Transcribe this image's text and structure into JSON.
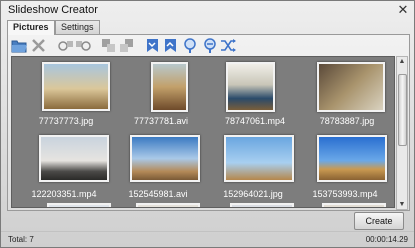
{
  "window": {
    "title": "Slideshow Creator"
  },
  "tabs": [
    {
      "label": "Pictures"
    },
    {
      "label": "Settings"
    }
  ],
  "toolbar": {
    "icons": [
      "open-folder-icon",
      "delete-icon",
      "move-left-icon",
      "move-right-icon",
      "move-up-icon",
      "move-down-icon",
      "sort-first-icon",
      "sort-last-icon",
      "zoom-in-icon",
      "zoom-out-icon",
      "shuffle-icon"
    ]
  },
  "items": [
    {
      "name": "77737773.jpg"
    },
    {
      "name": "77737781.avi"
    },
    {
      "name": "78747061.mp4"
    },
    {
      "name": "78783887.jpg"
    },
    {
      "name": "122203351.mp4"
    },
    {
      "name": "152545981.avi"
    },
    {
      "name": "152964021.jpg"
    },
    {
      "name": "153753993.mp4"
    }
  ],
  "buttons": {
    "create": "Create"
  },
  "status": {
    "total": "Total: 7",
    "duration": "00:00:14.29"
  }
}
